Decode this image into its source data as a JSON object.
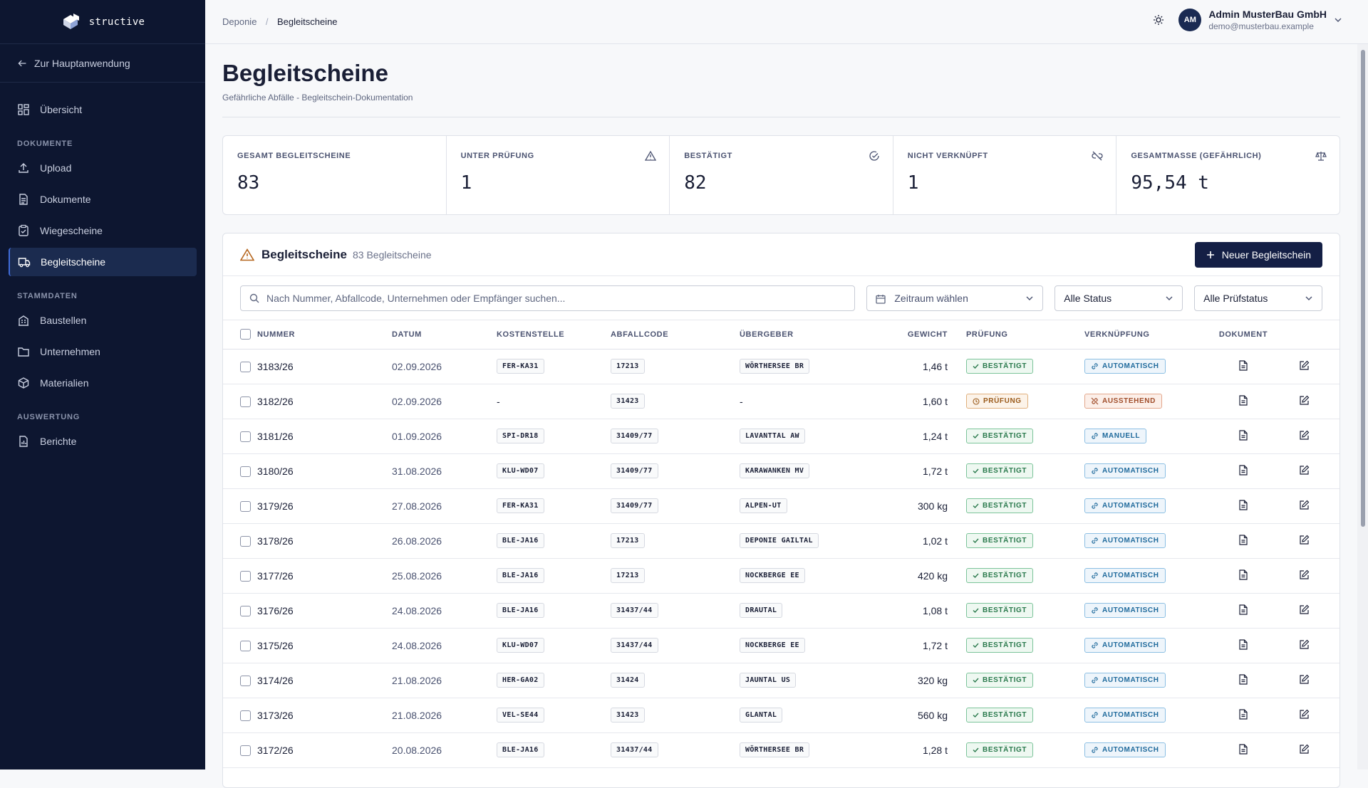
{
  "brand": {
    "name": "structive"
  },
  "sidebar": {
    "back_label": "Zur Hauptanwendung",
    "overview": "Übersicht",
    "section_docs": "DOKUMENTE",
    "section_master": "STAMMDATEN",
    "section_eval": "AUSWERTUNG",
    "items": [
      {
        "label": "Upload"
      },
      {
        "label": "Dokumente"
      },
      {
        "label": "Wiegescheine"
      },
      {
        "label": "Begleitscheine"
      },
      {
        "label": "Baustellen"
      },
      {
        "label": "Unternehmen"
      },
      {
        "label": "Materialien"
      },
      {
        "label": "Berichte"
      }
    ]
  },
  "breadcrumb": {
    "parent": "Deponie",
    "separator": "/",
    "current": "Begleitscheine"
  },
  "user": {
    "initials": "AM",
    "name": "Admin MusterBau GmbH",
    "email": "demo@musterbau.example"
  },
  "page": {
    "title": "Begleitscheine",
    "subtitle": "Gefährliche Abfälle - Begleitschein-Dokumentation"
  },
  "stats": [
    {
      "label": "GESAMT BEGLEITSCHEINE",
      "value": "83"
    },
    {
      "label": "UNTER PRÜFUNG",
      "value": "1"
    },
    {
      "label": "BESTÄTIGT",
      "value": "82"
    },
    {
      "label": "NICHT VERKNÜPFT",
      "value": "1"
    },
    {
      "label": "GESAMTMASSE (GEFÄHRLICH)",
      "value": "95,54 t"
    }
  ],
  "card": {
    "title": "Begleitscheine",
    "count": "83 Begleitscheine",
    "new_button": "Neuer Begleitschein"
  },
  "filters": {
    "search_placeholder": "Nach Nummer, Abfallcode, Unternehmen oder Empfänger suchen...",
    "period": "Zeitraum wählen",
    "status": "Alle Status",
    "check_status": "Alle Prüfstatus"
  },
  "table": {
    "columns": [
      "NUMMER",
      "DATUM",
      "KOSTENSTELLE",
      "ABFALLCODE",
      "ÜBERGEBER",
      "GEWICHT",
      "PRÜFUNG",
      "VERKNÜPFUNG",
      "DOKUMENT"
    ],
    "rows": [
      {
        "nummer": "3183/26",
        "datum": "02.09.2026",
        "kostenstelle": "FER-KA31",
        "abfallcode": "17213",
        "uebergeber": "WÖRTHERSEE BR",
        "gewicht": "1,46 t",
        "pruefung": "BESTÄTIGT",
        "verknuepfung": "AUTOMATISCH"
      },
      {
        "nummer": "3182/26",
        "datum": "02.09.2026",
        "kostenstelle": "-",
        "abfallcode": "31423",
        "uebergeber": "-",
        "gewicht": "1,60 t",
        "pruefung": "PRÜFUNG",
        "verknuepfung": "AUSSTEHEND"
      },
      {
        "nummer": "3181/26",
        "datum": "01.09.2026",
        "kostenstelle": "SPI-DR18",
        "abfallcode": "31409/77",
        "uebergeber": "LAVANTTAL AW",
        "gewicht": "1,24 t",
        "pruefung": "BESTÄTIGT",
        "verknuepfung": "MANUELL"
      },
      {
        "nummer": "3180/26",
        "datum": "31.08.2026",
        "kostenstelle": "KLU-WD07",
        "abfallcode": "31409/77",
        "uebergeber": "KARAWANKEN MV",
        "gewicht": "1,72 t",
        "pruefung": "BESTÄTIGT",
        "verknuepfung": "AUTOMATISCH"
      },
      {
        "nummer": "3179/26",
        "datum": "27.08.2026",
        "kostenstelle": "FER-KA31",
        "abfallcode": "31409/77",
        "uebergeber": "ALPEN-UT",
        "gewicht": "300 kg",
        "pruefung": "BESTÄTIGT",
        "verknuepfung": "AUTOMATISCH"
      },
      {
        "nummer": "3178/26",
        "datum": "26.08.2026",
        "kostenstelle": "BLE-JA16",
        "abfallcode": "17213",
        "uebergeber": "DEPONIE GAILTAL",
        "gewicht": "1,02 t",
        "pruefung": "BESTÄTIGT",
        "verknuepfung": "AUTOMATISCH"
      },
      {
        "nummer": "3177/26",
        "datum": "25.08.2026",
        "kostenstelle": "BLE-JA16",
        "abfallcode": "17213",
        "uebergeber": "NOCKBERGE EE",
        "gewicht": "420 kg",
        "pruefung": "BESTÄTIGT",
        "verknuepfung": "AUTOMATISCH"
      },
      {
        "nummer": "3176/26",
        "datum": "24.08.2026",
        "kostenstelle": "BLE-JA16",
        "abfallcode": "31437/44",
        "uebergeber": "DRAUTAL",
        "gewicht": "1,08 t",
        "pruefung": "BESTÄTIGT",
        "verknuepfung": "AUTOMATISCH"
      },
      {
        "nummer": "3175/26",
        "datum": "24.08.2026",
        "kostenstelle": "KLU-WD07",
        "abfallcode": "31437/44",
        "uebergeber": "NOCKBERGE EE",
        "gewicht": "1,72 t",
        "pruefung": "BESTÄTIGT",
        "verknuepfung": "AUTOMATISCH"
      },
      {
        "nummer": "3174/26",
        "datum": "21.08.2026",
        "kostenstelle": "HER-GA02",
        "abfallcode": "31424",
        "uebergeber": "JAUNTAL US",
        "gewicht": "320 kg",
        "pruefung": "BESTÄTIGT",
        "verknuepfung": "AUTOMATISCH"
      },
      {
        "nummer": "3173/26",
        "datum": "21.08.2026",
        "kostenstelle": "VEL-SE44",
        "abfallcode": "31423",
        "uebergeber": "GLANTAL",
        "gewicht": "560 kg",
        "pruefung": "BESTÄTIGT",
        "verknuepfung": "AUTOMATISCH"
      },
      {
        "nummer": "3172/26",
        "datum": "20.08.2026",
        "kostenstelle": "BLE-JA16",
        "abfallcode": "31437/44",
        "uebergeber": "WÖRTHERSEE BR",
        "gewicht": "1,28 t",
        "pruefung": "BESTÄTIGT",
        "verknuepfung": "AUTOMATISCH"
      }
    ]
  },
  "colors": {
    "sidebar_bg": "#0d1630",
    "primary_button": "#141f45",
    "ok": "#2a7a4d",
    "pending": "#9a5a1a",
    "link": "#1f6a9c"
  }
}
